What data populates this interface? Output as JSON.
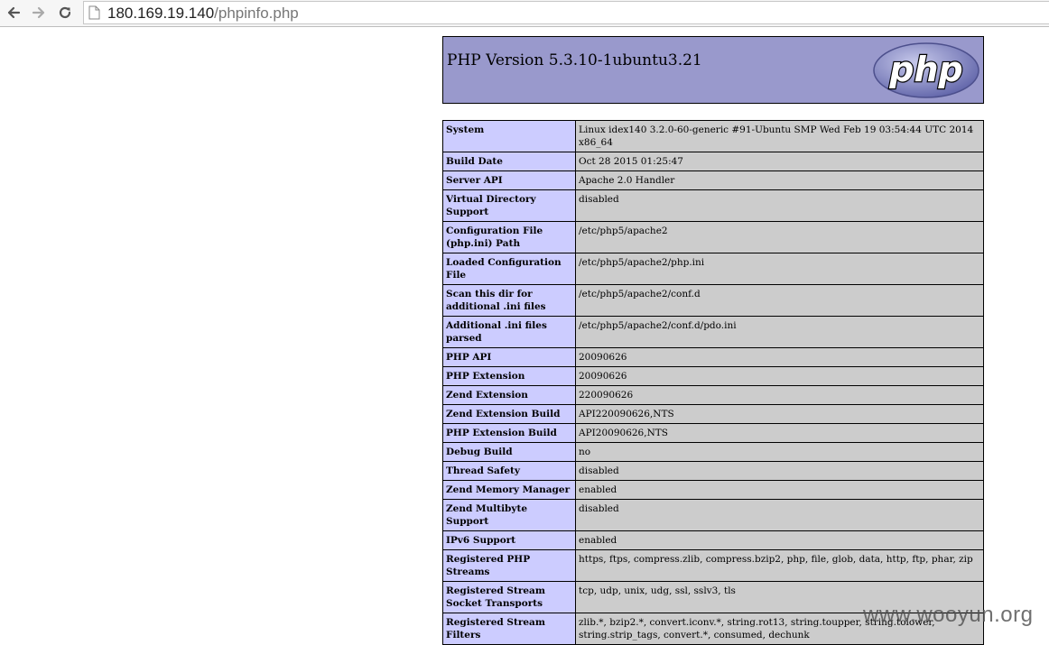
{
  "browser": {
    "url_host": "180.169.19.140",
    "url_path": "/phpinfo.php"
  },
  "phpinfo": {
    "title": "PHP Version 5.3.10-1ubuntu3.21",
    "logo_text": "php",
    "rows": [
      {
        "key": "System",
        "value": "Linux idex140 3.2.0-60-generic #91-Ubuntu SMP Wed Feb 19 03:54:44 UTC 2014 x86_64"
      },
      {
        "key": "Build Date",
        "value": "Oct 28 2015 01:25:47"
      },
      {
        "key": "Server API",
        "value": "Apache 2.0 Handler"
      },
      {
        "key": "Virtual Directory Support",
        "value": "disabled"
      },
      {
        "key": "Configuration File (php.ini) Path",
        "value": "/etc/php5/apache2"
      },
      {
        "key": "Loaded Configuration File",
        "value": "/etc/php5/apache2/php.ini"
      },
      {
        "key": "Scan this dir for additional .ini files",
        "value": "/etc/php5/apache2/conf.d"
      },
      {
        "key": "Additional .ini files parsed",
        "value": "/etc/php5/apache2/conf.d/pdo.ini"
      },
      {
        "key": "PHP API",
        "value": "20090626"
      },
      {
        "key": "PHP Extension",
        "value": "20090626"
      },
      {
        "key": "Zend Extension",
        "value": "220090626"
      },
      {
        "key": "Zend Extension Build",
        "value": "API220090626,NTS"
      },
      {
        "key": "PHP Extension Build",
        "value": "API20090626,NTS"
      },
      {
        "key": "Debug Build",
        "value": "no"
      },
      {
        "key": "Thread Safety",
        "value": "disabled"
      },
      {
        "key": "Zend Memory Manager",
        "value": "enabled"
      },
      {
        "key": "Zend Multibyte Support",
        "value": "disabled"
      },
      {
        "key": "IPv6 Support",
        "value": "enabled"
      },
      {
        "key": "Registered PHP Streams",
        "value": "https, ftps, compress.zlib, compress.bzip2, php, file, glob, data, http, ftp, phar, zip"
      },
      {
        "key": "Registered Stream Socket Transports",
        "value": "tcp, udp, unix, udg, ssl, sslv3, tls"
      },
      {
        "key": "Registered Stream Filters",
        "value": "zlib.*, bzip2.*, convert.iconv.*, string.rot13, string.toupper, string.tolower, string.strip_tags, convert.*, consumed, dechunk"
      }
    ]
  },
  "watermark": "www.wooyun.org",
  "colors": {
    "header_bg": "#9999cc",
    "key_bg": "#ccccff",
    "value_bg": "#cccccc"
  },
  "icons": [
    "back-arrow-icon",
    "forward-arrow-icon",
    "reload-icon",
    "page-icon",
    "php-logo"
  ]
}
